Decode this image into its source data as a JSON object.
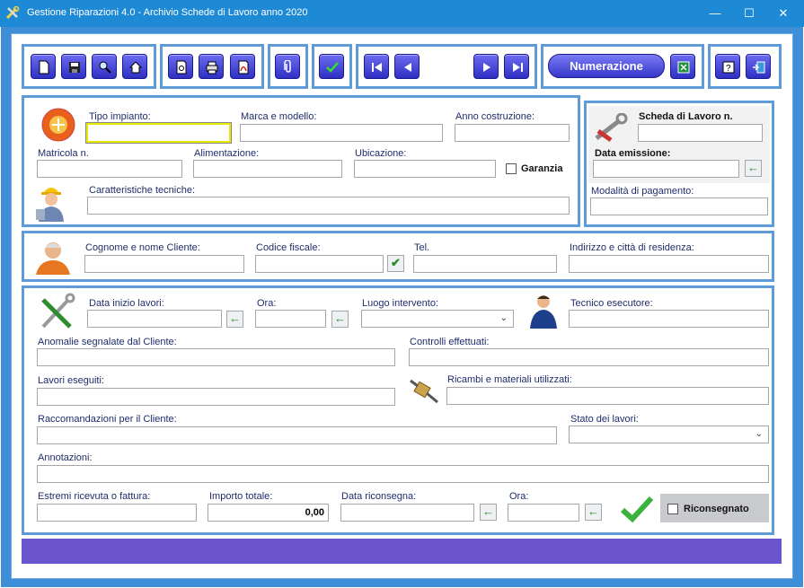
{
  "window": {
    "title": "Gestione Riparazioni 4.0 - Archivio Schede di Lavoro anno 2020",
    "minimize": "—",
    "maximize": "☐",
    "close": "✕"
  },
  "toolbar": {
    "numerazione": "Numerazione"
  },
  "impianto": {
    "tipo_label": "Tipo impianto:",
    "tipo_value": "",
    "marca_label": "Marca e modello:",
    "marca_value": "",
    "anno_label": "Anno costruzione:",
    "anno_value": "",
    "matricola_label": "Matricola n.",
    "matricola_value": "",
    "alimentazione_label": "Alimentazione:",
    "alimentazione_value": "",
    "ubicazione_label": "Ubicazione:",
    "ubicazione_value": "",
    "garanzia_label": "Garanzia",
    "caratteristiche_label": "Caratteristiche tecniche:",
    "caratteristiche_value": ""
  },
  "scheda": {
    "numero_label": "Scheda di Lavoro n.",
    "numero_value": "",
    "data_label": "Data emissione:",
    "data_value": "",
    "pagamento_label": "Modalità di pagamento:",
    "pagamento_value": ""
  },
  "cliente": {
    "nome_label": "Cognome e nome Cliente:",
    "nome_value": "",
    "cf_label": "Codice fiscale:",
    "cf_value": "",
    "tel_label": "Tel.",
    "tel_value": "",
    "indirizzo_label": "Indirizzo e città di residenza:",
    "indirizzo_value": ""
  },
  "lavori": {
    "data_inizio_label": "Data inizio lavori:",
    "data_inizio_value": "",
    "ora_label": "Ora:",
    "ora_value": "",
    "luogo_label": "Luogo intervento:",
    "luogo_value": "",
    "tecnico_label": "Tecnico esecutore:",
    "tecnico_value": "",
    "anomalie_label": "Anomalie segnalate dal Cliente:",
    "anomalie_value": "",
    "controlli_label": "Controlli effettuati:",
    "controlli_value": "",
    "eseguiti_label": "Lavori eseguiti:",
    "eseguiti_value": "",
    "ricambi_label": "Ricambi e materiali utilizzati:",
    "ricambi_value": "",
    "raccomandazioni_label": "Raccomandazioni per il Cliente:",
    "raccomandazioni_value": "",
    "stato_label": "Stato dei lavori:",
    "stato_value": "",
    "annotazioni_label": "Annotazioni:",
    "annotazioni_value": "",
    "ricevuta_label": "Estremi ricevuta o fattura:",
    "ricevuta_value": "",
    "importo_label": "Importo totale:",
    "importo_value": "0,00",
    "riconsegna_label": "Data riconsegna:",
    "riconsegna_value": "",
    "ora2_label": "Ora:",
    "ora2_value": "",
    "riconsegnato_label": "Riconsegnato"
  },
  "icons": {
    "arrow": "←",
    "check": "✔",
    "chevron": "⌄"
  }
}
